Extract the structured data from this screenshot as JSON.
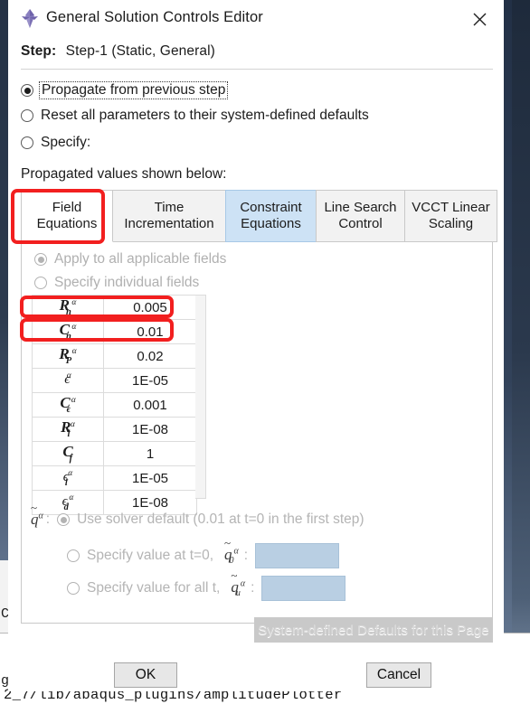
{
  "window": {
    "title": "General Solution Controls Editor",
    "icon": "abaqus-diamond-icon",
    "close_label": "×"
  },
  "step": {
    "label": "Step:",
    "value": "Step-1 (Static, General)"
  },
  "mode_options": [
    {
      "label": "Propagate from previous step",
      "checked": true,
      "focused": true
    },
    {
      "label": "Reset all parameters to their system-defined defaults",
      "checked": false,
      "focused": false
    },
    {
      "label": "Specify:",
      "checked": false,
      "focused": false
    }
  ],
  "note": "Propagated values shown below:",
  "tabs": [
    {
      "label_line1": "Field",
      "label_line2": "Equations",
      "state": "selected"
    },
    {
      "label_line1": "Time",
      "label_line2": "Incrementation",
      "state": "normal"
    },
    {
      "label_line1": "Constraint",
      "label_line2": "Equations",
      "state": "hovered"
    },
    {
      "label_line1": "Line Search",
      "label_line2": "Control",
      "state": "normal"
    },
    {
      "label_line1": "VCCT Linear",
      "label_line2": "Scaling",
      "state": "normal"
    }
  ],
  "panel": {
    "field_options": [
      {
        "label": "Apply to all applicable fields",
        "checked": true,
        "disabled": true
      },
      {
        "label": "Specify individual fields",
        "checked": false,
        "disabled": true
      }
    ],
    "table": {
      "rows": [
        {
          "base": "R",
          "sup": "α",
          "sub": "n",
          "value": "0.005"
        },
        {
          "base": "C",
          "sup": "α",
          "sub": "n",
          "value": "0.01"
        },
        {
          "base": "R",
          "sup": "α",
          "sub": "P",
          "value": "0.02"
        },
        {
          "base": "ϵ",
          "sup": "α",
          "sub": "",
          "value": "1E-05"
        },
        {
          "base": "C",
          "sup": "α",
          "sub": "ϵ",
          "value": "0.001"
        },
        {
          "base": "R",
          "sup": "α",
          "sub": "l",
          "value": "1E-08"
        },
        {
          "base": "C",
          "sup": "",
          "sub": "f",
          "value": "1"
        },
        {
          "base": "ϵ",
          "sup": "α",
          "sub": "l",
          "value": "1E-05"
        },
        {
          "base": "ϵ",
          "sup": "α",
          "sub": "d",
          "value": "1E-08"
        }
      ]
    },
    "q_group": {
      "symbol_base": "q",
      "symbol_sup": "α",
      "colon": ":",
      "options": [
        {
          "label": "Use solver default  (0.01 at t=0 in the first step)",
          "checked": true,
          "disabled": true,
          "symbol_sub": "",
          "has_input": false,
          "input_value": ""
        },
        {
          "label": "Specify value at t=0,",
          "checked": false,
          "disabled": true,
          "symbol_sub": "0",
          "has_input": true,
          "input_value": ""
        },
        {
          "label": "Specify value for all t,",
          "checked": false,
          "disabled": true,
          "symbol_sub": "u",
          "has_input": true,
          "input_value": ""
        }
      ]
    },
    "defaults_button": "System-defined Defaults for this Page"
  },
  "footer": {
    "ok": "OK",
    "cancel": "Cancel"
  },
  "background": {
    "left_text_1": "C",
    "left_text_2": "g",
    "bottom_text": "2_7/lib/abaqus_plugins/amplitudePlotter"
  },
  "colors": {
    "annotation_red": "#f21f1f",
    "tab_hover_blue": "#cde2f5",
    "input_disabled_blue": "#b9cfe3",
    "icon_purple": "#7a6fb0"
  }
}
